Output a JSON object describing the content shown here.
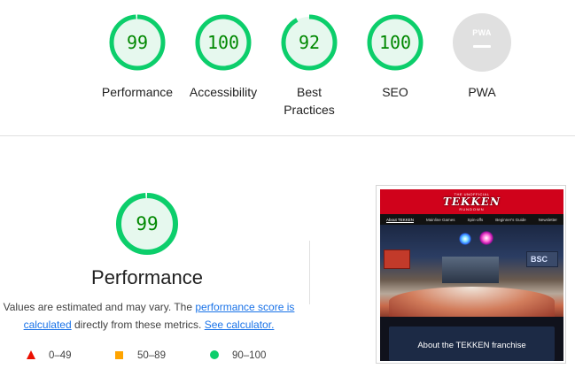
{
  "scores": [
    {
      "label": "Performance",
      "score": "99",
      "value": 99
    },
    {
      "label": "Accessibility",
      "score": "100",
      "value": 100
    },
    {
      "label": "Best Practices",
      "score": "92",
      "value": 92
    },
    {
      "label": "SEO",
      "score": "100",
      "value": 100
    }
  ],
  "pwa": {
    "label": "PWA",
    "badge_text": "PWA"
  },
  "performance": {
    "score": "99",
    "value": 99,
    "title": "Performance",
    "desc_prefix": "Values are estimated and may vary. The ",
    "desc_link1": "performance score is calculated",
    "desc_middle": " directly from these metrics. ",
    "desc_link2": "See calculator."
  },
  "legend": {
    "fail": "0–49",
    "average": "50–89",
    "pass": "90–100"
  },
  "colors": {
    "pass": "#0cce6b",
    "pass_text": "#008800",
    "average": "#ffa400",
    "fail": "#eb0f00",
    "link": "#1a73e8"
  },
  "screenshot": {
    "logo_top": "THE UNOFFICIAL",
    "logo_main": "TEKKEN",
    "logo_bottom": "RUNDOWN",
    "nav": [
      "About TEKKEN",
      "Mainline Games",
      "Spin-offs",
      "Beginner's Guide",
      "Newsletter"
    ],
    "screen_text": "BSC",
    "card_text": "About the TEKKEN franchise"
  }
}
